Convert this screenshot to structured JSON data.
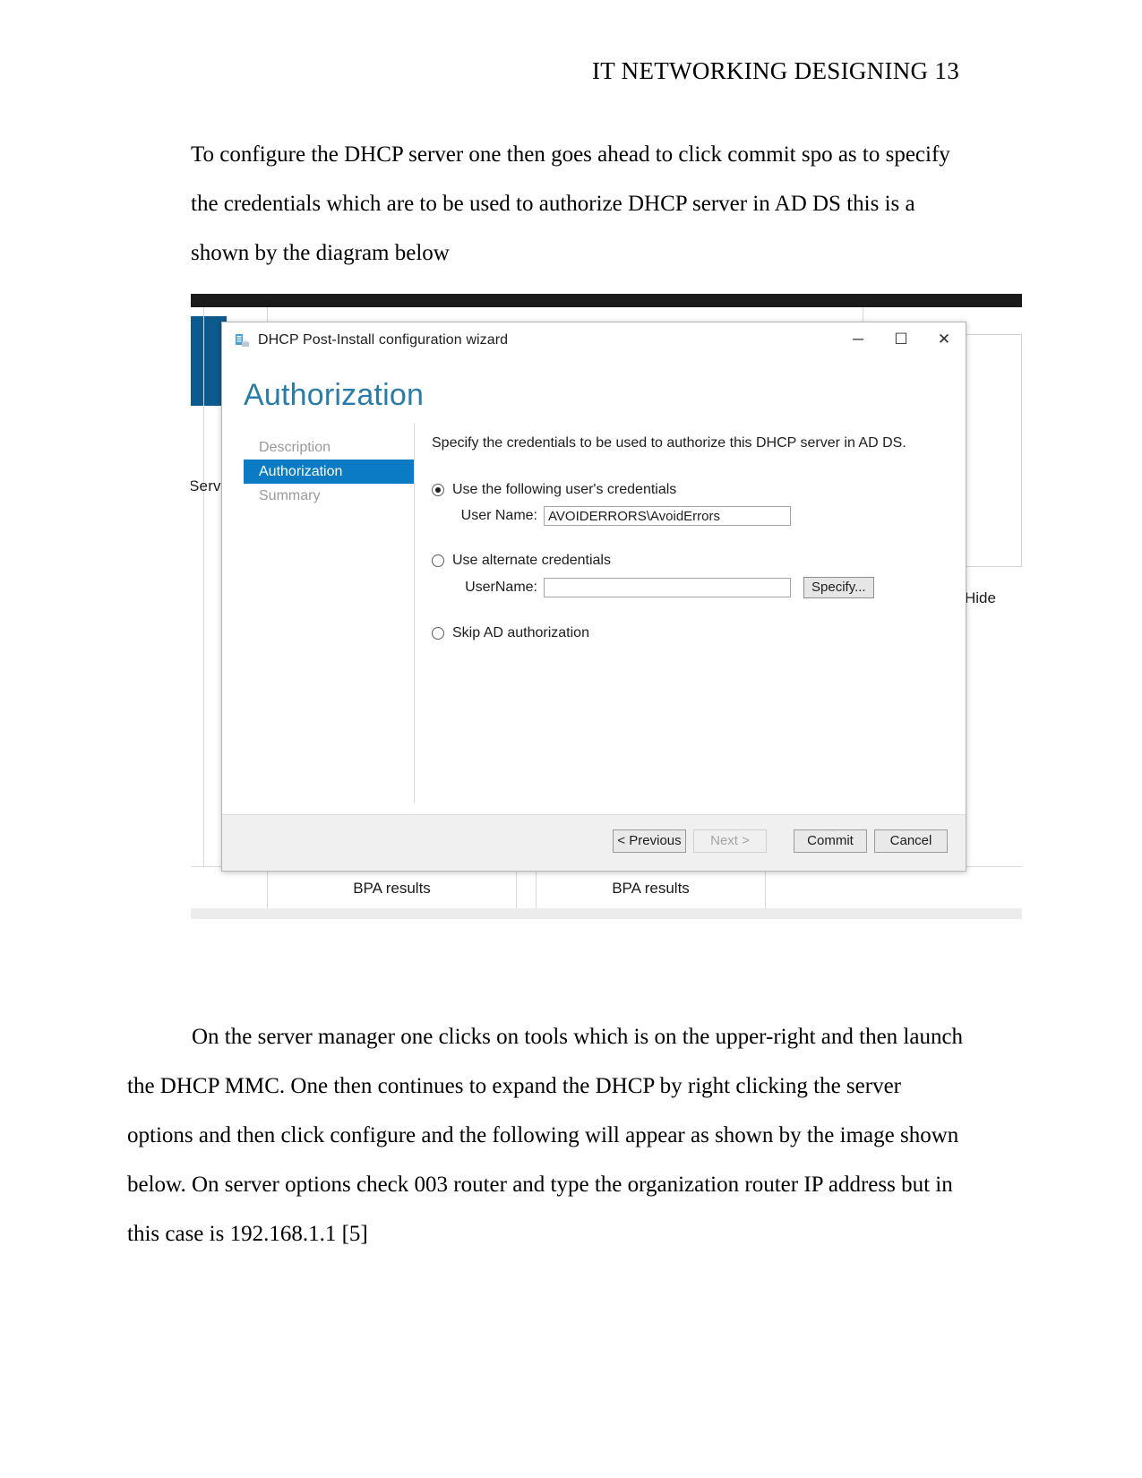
{
  "document": {
    "header": "IT NETWORKING DESIGNING 13",
    "paragraph_top": "To configure the DHCP server one then  goes ahead to click commit spo as to specify the credentials which are to be used to authorize DHCP server in AD DS this is a shown by the diagram below",
    "paragraph_bottom": "On the server manager one clicks on tools which is on the upper-right and then launch the DHCP MMC. One then continues to expand the DHCP by right clicking the server options and then click configure and the following will appear as shown by the image shown below. On server options check 003 router and type the organization router IP address but in this case is 192.168.1.1 [5]"
  },
  "screenshot": {
    "background_app": {
      "service_label": "Servic",
      "hide_label": "Hide",
      "bpa_cells": [
        {
          "label": "BPA results"
        },
        {
          "label": "BPA results"
        }
      ]
    },
    "dialog": {
      "title": "DHCP Post-Install configuration wizard",
      "title_icon": "dhcp-wizard-icon",
      "window_buttons": {
        "minimize": "─",
        "maximize": "☐",
        "close": "✕"
      },
      "heading": "Authorization",
      "nav": [
        {
          "label": "Description",
          "selected": false
        },
        {
          "label": "Authorization",
          "selected": true
        },
        {
          "label": "Summary",
          "selected": false
        }
      ],
      "intro": "Specify the credentials to be used to authorize this DHCP server in AD DS.",
      "options": [
        {
          "label": "Use the following user's credentials",
          "checked": true,
          "field_label": "User Name:",
          "field_value": "AVOIDERRORS\\AvoidErrors",
          "field_placeholder": ""
        },
        {
          "label": "Use alternate credentials",
          "checked": false,
          "field_label": "UserName:",
          "field_value": "",
          "field_placeholder": "",
          "button_label": "Specify..."
        },
        {
          "label": "Skip AD authorization",
          "checked": false
        }
      ],
      "footer_buttons": [
        {
          "label": "< Previous",
          "disabled": false
        },
        {
          "label": "Next >",
          "disabled": true
        },
        {
          "label": "Commit",
          "disabled": false
        },
        {
          "label": "Cancel",
          "disabled": false
        }
      ]
    },
    "accent_colors": {
      "heading_teal": "#2a7ca8",
      "nav_selected_blue": "#0a7bc4",
      "server_manager_blue": "#0d5a8e"
    }
  }
}
